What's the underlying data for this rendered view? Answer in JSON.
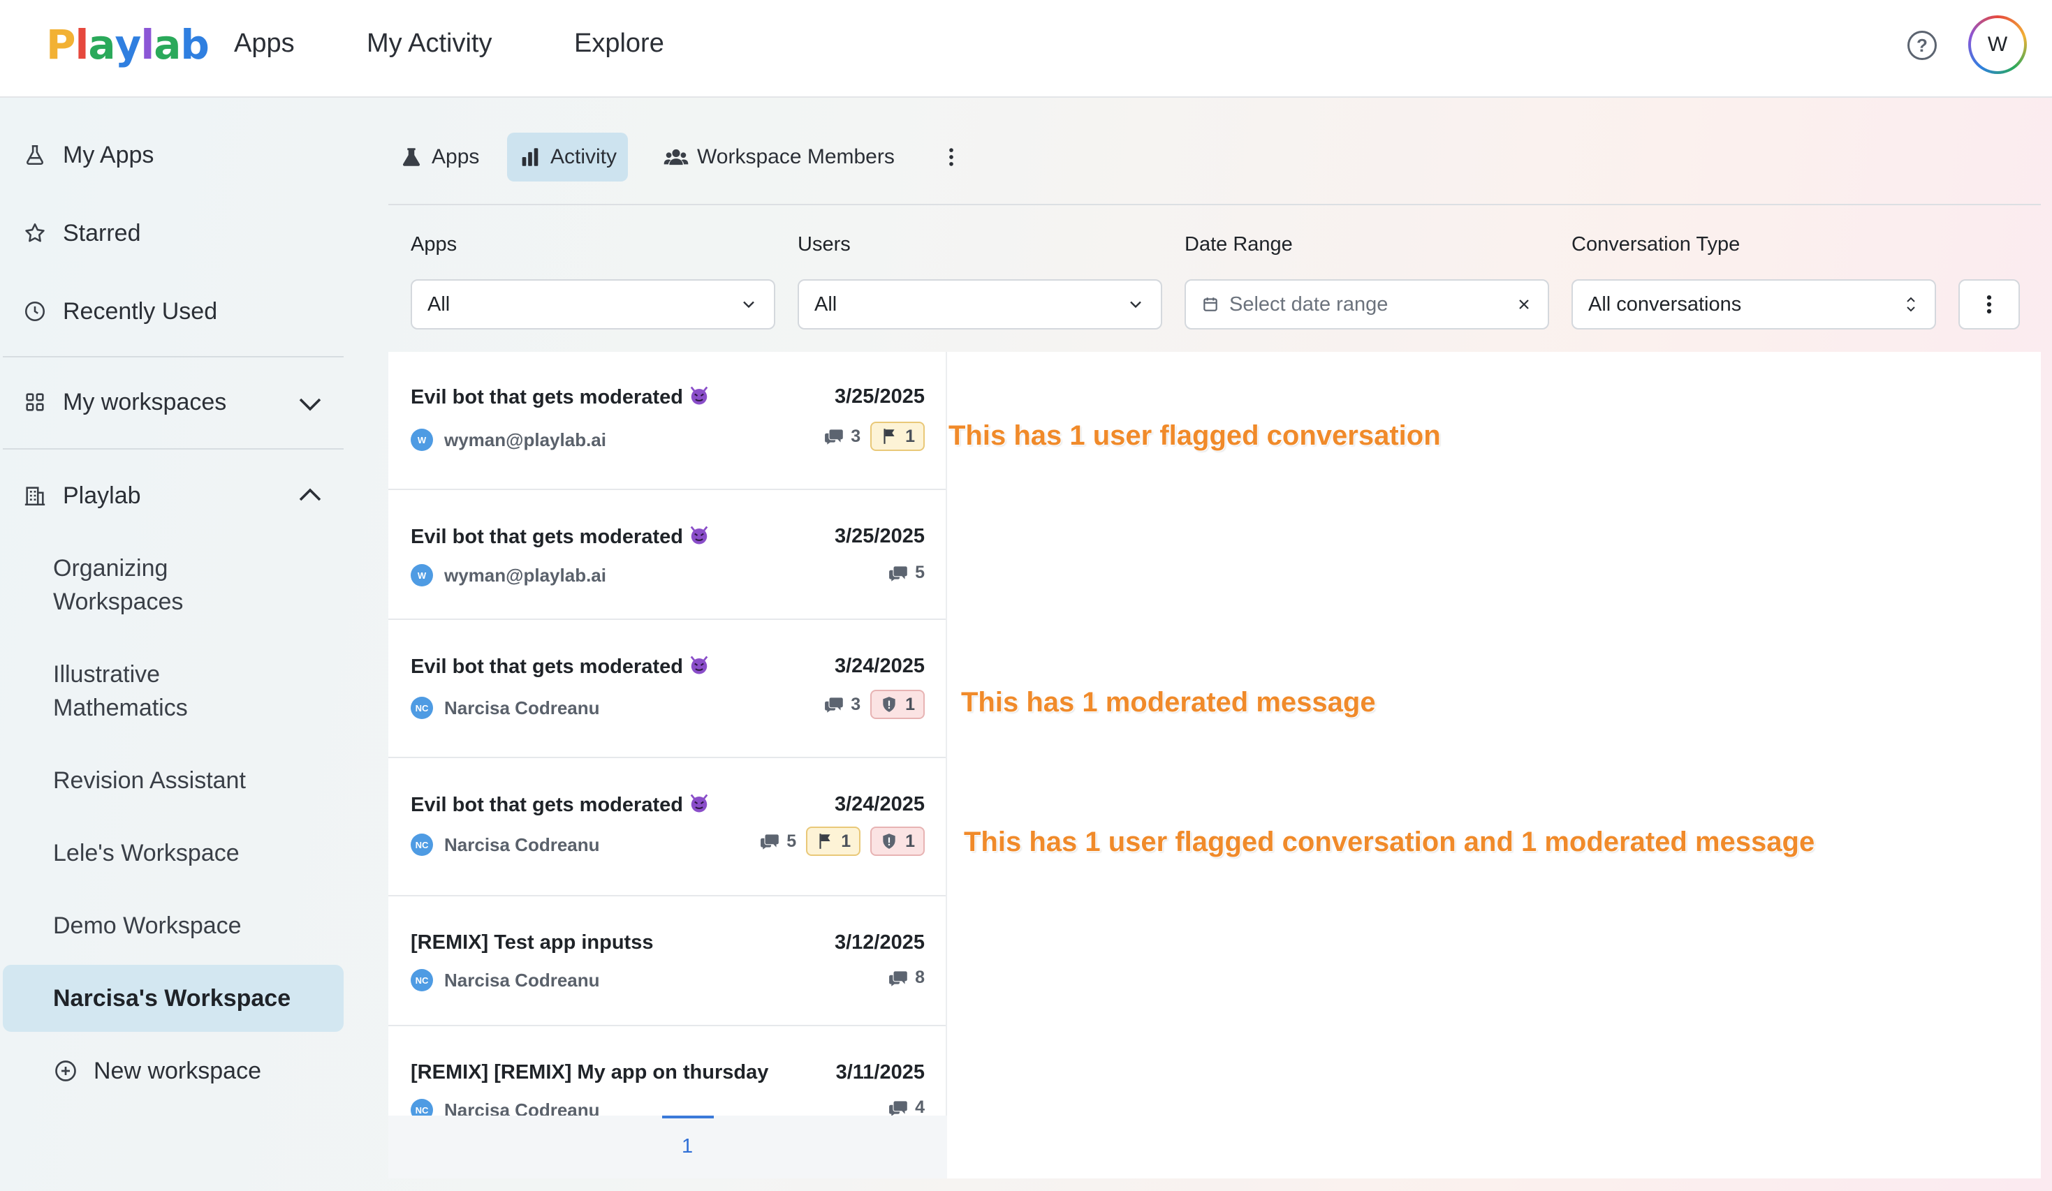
{
  "header": {
    "logo_text": "Playlab",
    "nav": [
      "Apps",
      "My Activity",
      "Explore"
    ],
    "help_icon": "help-circle-icon",
    "avatar_initial": "W"
  },
  "sidebar": {
    "items": [
      {
        "label": "My Apps",
        "icon": "flask-icon"
      },
      {
        "label": "Starred",
        "icon": "star-icon"
      },
      {
        "label": "Recently Used",
        "icon": "clock-icon"
      }
    ],
    "workspaces_label": "My workspaces",
    "org_label": "Playlab",
    "workspaces": [
      {
        "label": "Organizing Workspaces"
      },
      {
        "label": "Illustrative Mathematics"
      },
      {
        "label": "Revision Assistant"
      },
      {
        "label": "Lele's Workspace"
      },
      {
        "label": "Demo Workspace"
      },
      {
        "label": "Narcisa's Workspace",
        "active": true
      }
    ],
    "new_workspace_label": "New workspace"
  },
  "tabs": [
    {
      "label": "Apps",
      "icon": "flask-icon"
    },
    {
      "label": "Activity",
      "icon": "bar-chart-icon",
      "active": true
    },
    {
      "label": "Workspace Members",
      "icon": "users-icon"
    }
  ],
  "filters": {
    "apps": {
      "label": "Apps",
      "value": "All"
    },
    "users": {
      "label": "Users",
      "value": "All"
    },
    "date_range": {
      "label": "Date Range",
      "placeholder": "Select date range"
    },
    "conversation_type": {
      "label": "Conversation Type",
      "value": "All conversations"
    }
  },
  "conversations": [
    {
      "title": "Evil bot that gets moderated",
      "emoji": true,
      "date": "3/25/2025",
      "user": "wyman@playlab.ai",
      "user_initials": "W",
      "messages": "3",
      "flags": "1",
      "moderated": null
    },
    {
      "title": "Evil bot that gets moderated",
      "emoji": true,
      "date": "3/25/2025",
      "user": "wyman@playlab.ai",
      "user_initials": "W",
      "messages": "5",
      "flags": null,
      "moderated": null
    },
    {
      "title": "Evil bot that gets moderated",
      "emoji": true,
      "date": "3/24/2025",
      "user": "Narcisa Codreanu",
      "user_initials": "NC",
      "messages": "3",
      "flags": null,
      "moderated": "1"
    },
    {
      "title": "Evil bot that gets moderated",
      "emoji": true,
      "date": "3/24/2025",
      "user": "Narcisa Codreanu",
      "user_initials": "NC",
      "messages": "5",
      "flags": "1",
      "moderated": "1"
    },
    {
      "title": "[REMIX] Test app inputss",
      "emoji": false,
      "date": "3/12/2025",
      "user": "Narcisa Codreanu",
      "user_initials": "NC",
      "messages": "8",
      "flags": null,
      "moderated": null
    },
    {
      "title": "[REMIX] [REMIX] My app on thursday",
      "emoji": false,
      "date": "3/11/2025",
      "user": "Narcisa Codreanu",
      "user_initials": "NC",
      "messages": "4",
      "flags": null,
      "moderated": null
    }
  ],
  "pagination": {
    "current": "1"
  },
  "annotations": [
    "This has 1 user flagged conversation",
    "This has 1 moderated message",
    "This has 1 user flagged conversation and 1 moderated message"
  ],
  "colors": {
    "accent": "#2f6fd6",
    "active_bg": "#d3e7f1",
    "annotation": "#f08a2a",
    "flag_bg": "#fdf3d6",
    "moderated_bg": "#fbe3e3"
  }
}
